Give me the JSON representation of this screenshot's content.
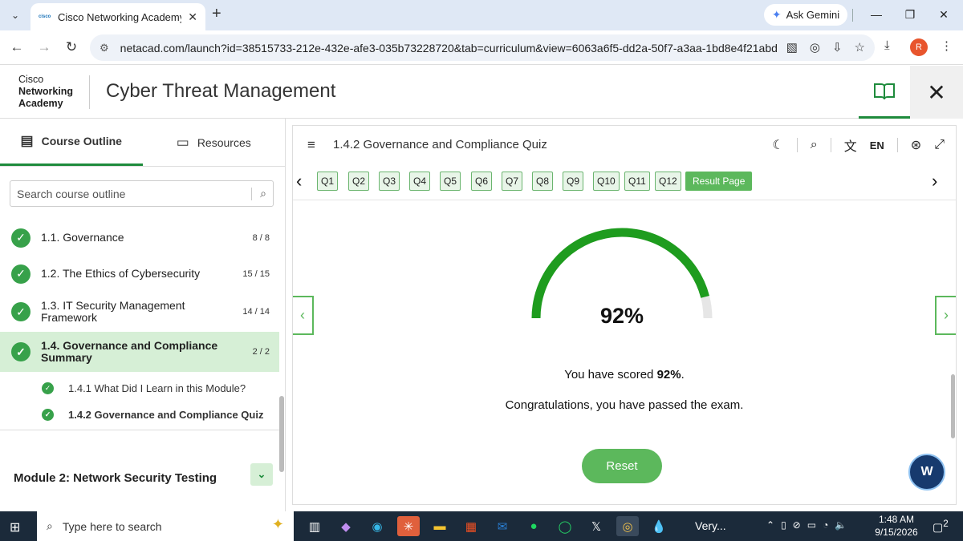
{
  "browser": {
    "tab_title": "Cisco Networking Academy: Cy",
    "tab_favicon": "cisco",
    "new_tab": "+",
    "ask_gemini": "Ask Gemini",
    "url": "netacad.com/launch?id=38515733-212e-432e-afe3-035b73228720&tab=curriculum&view=6063a6f5-dd2a-50f7-a3aa-1bd8e4f21abd",
    "profile_initial": "R"
  },
  "header": {
    "logo_line1": "Cisco",
    "logo_line2": "Networking",
    "logo_line3": "Academy",
    "course_title": "Cyber Threat Management"
  },
  "sidebar": {
    "tab_outline": "Course Outline",
    "tab_resources": "Resources",
    "search_placeholder": "Search course outline",
    "items": [
      {
        "label": "1.1. Governance",
        "count": "8 / 8"
      },
      {
        "label": "1.2. The Ethics of Cybersecurity",
        "count": "15 / 15"
      },
      {
        "label": "1.3. IT Security Management Framework",
        "count": "14 / 14"
      },
      {
        "label": "1.4. Governance and Compliance Summary",
        "count": "2 / 2"
      }
    ],
    "subitems": [
      {
        "label": "1.4.1 What Did I Learn in this Module?"
      },
      {
        "label": "1.4.2 Governance and Compliance Quiz"
      }
    ],
    "module": "Module 2: Network Security Testing"
  },
  "quiz": {
    "title": "1.4.2 Governance and Compliance Quiz",
    "language": "EN",
    "questions": [
      "Q1",
      "Q2",
      "Q3",
      "Q4",
      "Q5",
      "Q6",
      "Q7",
      "Q8",
      "Q9",
      "Q10",
      "Q11",
      "Q12"
    ],
    "result_label": "Result Page",
    "score_fraction": 0.92,
    "score_text": "92%",
    "scored_prefix": "You have scored ",
    "scored_value": "92%",
    "scored_suffix": ".",
    "congrats": "Congratulations, you have passed the exam.",
    "reset": "Reset",
    "colors": {
      "accent": "#1e8b3c",
      "gauge": "#1e9c1e",
      "gauge_track": "#e6e6e6",
      "button": "#5cb85c"
    }
  },
  "taskbar": {
    "search_placeholder": "Type here to search",
    "very_label": "Very...",
    "time": "1:48 AM",
    "date": "9/15/2026",
    "notifications": "2"
  }
}
